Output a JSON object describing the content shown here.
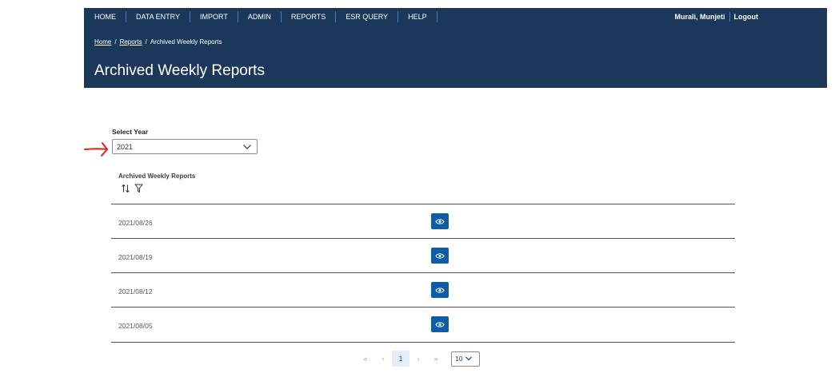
{
  "nav": {
    "items": [
      "HOME",
      "DATA ENTRY",
      "IMPORT",
      "ADMIN",
      "REPORTS",
      "ESR QUERY",
      "HELP"
    ],
    "user_name": "Murali, Munjeti",
    "logout": "Logout"
  },
  "breadcrumb": {
    "home": "Home",
    "reports": "Reports",
    "current": "Archived Weekly Reports",
    "separator": "/"
  },
  "page": {
    "title": "Archived Weekly Reports"
  },
  "year_filter": {
    "label": "Select Year",
    "value": "2021"
  },
  "table": {
    "column_header": "Archived Weekly Reports",
    "rows": [
      {
        "date": "2021/08/26"
      },
      {
        "date": "2021/08/19"
      },
      {
        "date": "2021/08/12"
      },
      {
        "date": "2021/08/05"
      }
    ]
  },
  "pagination": {
    "first": "«",
    "prev": "‹",
    "current_page": "1",
    "next": "›",
    "last": "»",
    "page_size": "10"
  },
  "colors": {
    "header_bg": "#1b3759",
    "accent": "#0c5ca8",
    "annotation_arrow": "#e0201c"
  }
}
